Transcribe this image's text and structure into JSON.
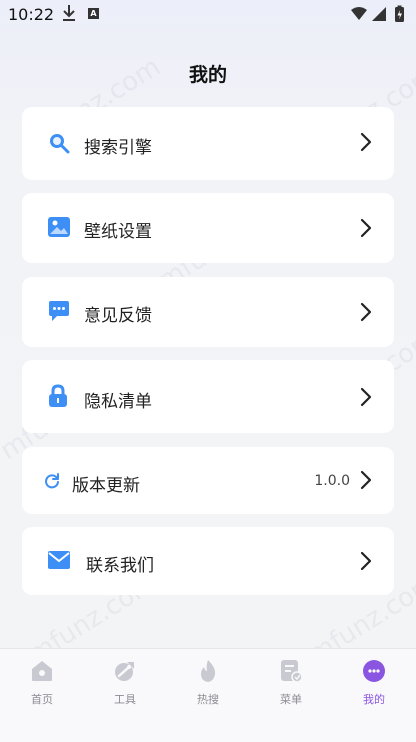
{
  "status_bar": {
    "time": "10:22",
    "icons": [
      "download-icon",
      "a-icon",
      "wifi-icon",
      "signal-icon",
      "battery-icon"
    ]
  },
  "page": {
    "title": "我的"
  },
  "menu": [
    {
      "label": "搜索引擎",
      "icon": "search-icon"
    },
    {
      "label": "壁纸设置",
      "icon": "image-icon"
    },
    {
      "label": "意见反馈",
      "icon": "chat-icon"
    },
    {
      "label": "隐私清单",
      "icon": "lock-icon"
    },
    {
      "label": "版本更新",
      "icon": "refresh-icon",
      "value": "1.0.0"
    },
    {
      "label": "联系我们",
      "icon": "mail-icon"
    }
  ],
  "watermark": "mfunz.com",
  "bottom_nav": {
    "items": [
      {
        "label": "首页",
        "icon": "home-icon"
      },
      {
        "label": "工具",
        "icon": "tools-icon"
      },
      {
        "label": "热搜",
        "icon": "flame-icon"
      },
      {
        "label": "菜单",
        "icon": "menu-doc-icon"
      },
      {
        "label": "我的",
        "icon": "profile-icon",
        "active": true
      }
    ]
  },
  "colors": {
    "accent": "#8a55e0",
    "icon_blue": "#3d8ff5",
    "inactive": "#c9c9d2"
  }
}
